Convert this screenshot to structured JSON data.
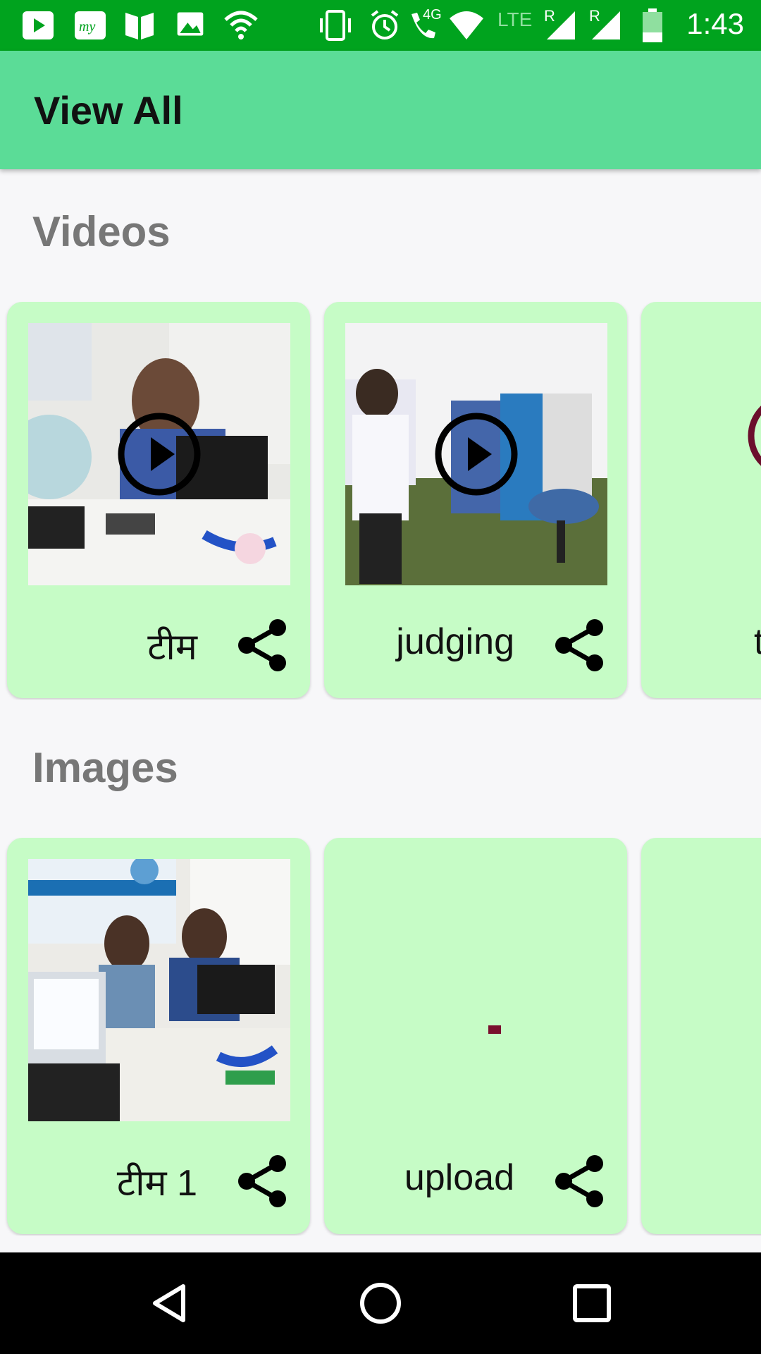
{
  "status_bar": {
    "time": "1:43",
    "network_label": "4G",
    "lte_label": "LTE",
    "roaming_label_1": "R",
    "roaming_label_2": "R",
    "icons": [
      "youtube-icon",
      "my-app-icon",
      "book-icon",
      "image-icon",
      "wifi-icon",
      "vibrate-icon",
      "alarm-icon",
      "call-4g-icon",
      "wifi-signal-icon",
      "lte-signal-icon",
      "signal-r-icon",
      "signal-r2-icon",
      "battery-icon"
    ],
    "color": "#00A31E"
  },
  "app_bar": {
    "title": "View All",
    "color": "#5BDC97"
  },
  "sections": {
    "videos": {
      "title": "Videos",
      "items": [
        {
          "caption": "टीम"
        },
        {
          "caption": "judging"
        },
        {
          "caption": "t"
        }
      ]
    },
    "images": {
      "title": "Images",
      "items": [
        {
          "caption": "टीम 1"
        },
        {
          "caption": "upload"
        },
        {
          "caption": ""
        }
      ]
    }
  },
  "colors": {
    "card": "#C6FCC6",
    "section_title": "#777777",
    "background": "#F7F7F9"
  },
  "nav_bar": {
    "icons": [
      "back-icon",
      "home-icon",
      "recents-icon"
    ]
  }
}
